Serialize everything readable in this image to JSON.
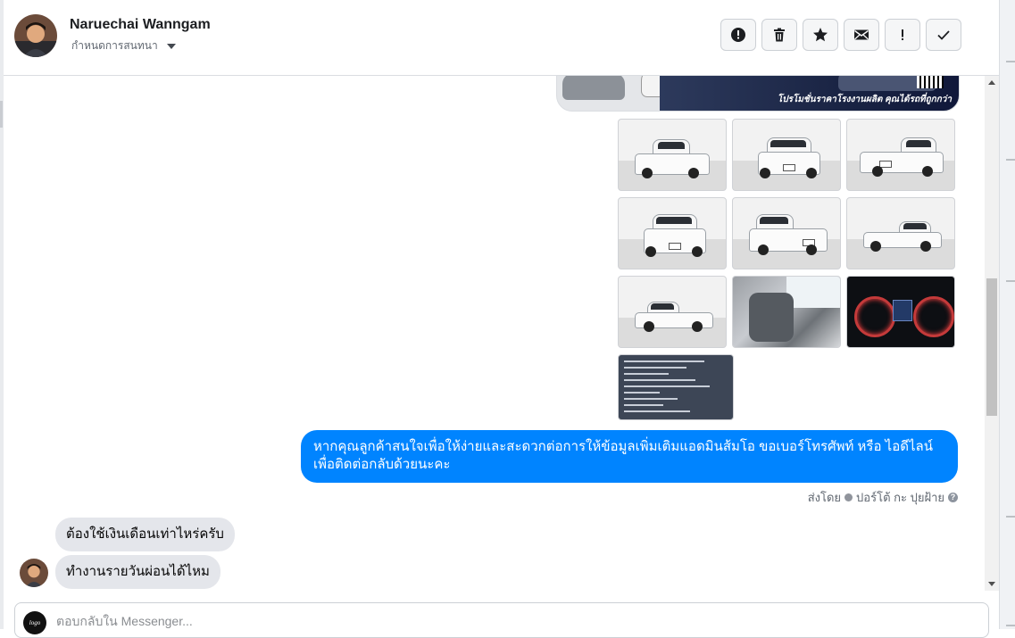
{
  "header": {
    "contact_name": "Naruechai Wanngam",
    "assign_label": "กำหนดการสนทนา",
    "actions": [
      {
        "name": "alert-button",
        "icon": "alert-circle-icon"
      },
      {
        "name": "delete-button",
        "icon": "trash-icon"
      },
      {
        "name": "star-button",
        "icon": "star-icon"
      },
      {
        "name": "mark-unread-button",
        "icon": "envelope-icon"
      },
      {
        "name": "important-button",
        "icon": "exclamation-icon"
      },
      {
        "name": "done-button",
        "icon": "checkmark-icon"
      }
    ]
  },
  "thread": {
    "banner_caption": "โปรโมชั่นราคาโรงงานผลิต คุณได้รถที่ถูกกว่า",
    "outgoing_message": {
      "line1": "หากคุณลูกค้าสนใจเพื่อให้ง่ายและสะดวกต่อการให้ข้อมูลเพิ่มเติมแอดมินส้มโอ ขอเบอร์โทรศัพท์ หรือ ไอดีไลน์",
      "line2": "เพื่อติดต่อกลับด้วยนะคะ"
    },
    "sent_by_prefix": "ส่งโดย",
    "sent_by_name": "ปอร์โต้ กะ ปุยฝ้าย",
    "incoming_messages": [
      "ต้องใช้เงินเดือนเท่าไหร่ครับ",
      "ทำงานรายวันผ่อนได้ไหม"
    ]
  },
  "reply": {
    "placeholder": "ตอบกลับใน Messenger..."
  },
  "colors": {
    "outgoing_bubble": "#0084ff",
    "incoming_bubble": "#e4e6eb"
  }
}
